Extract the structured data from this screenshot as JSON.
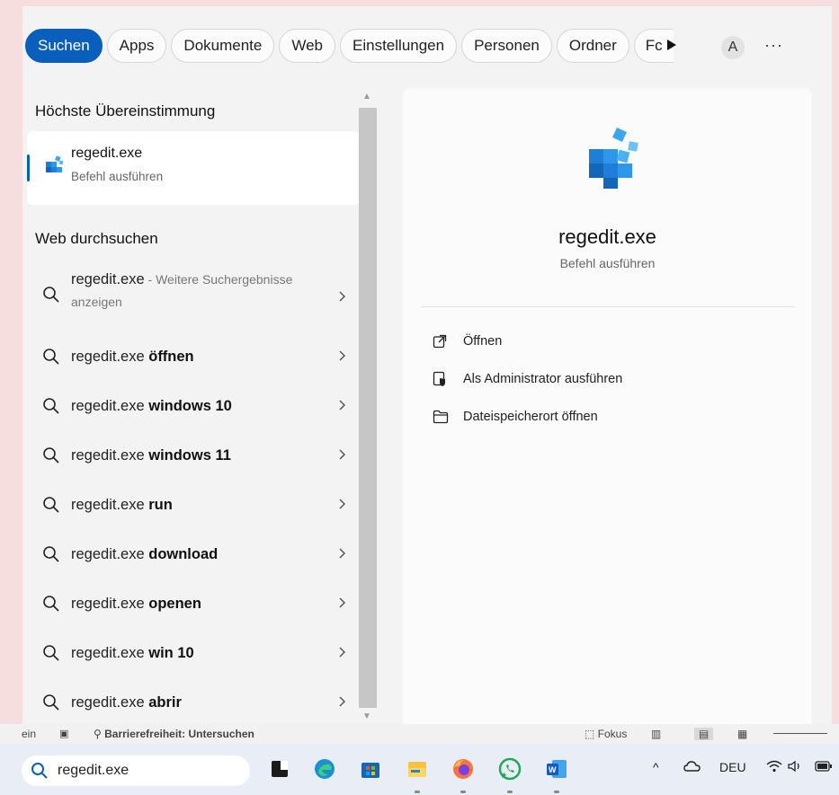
{
  "tabs": [
    {
      "label": "Suchen",
      "active": true
    },
    {
      "label": "Apps"
    },
    {
      "label": "Dokumente"
    },
    {
      "label": "Web"
    },
    {
      "label": "Einstellungen"
    },
    {
      "label": "Personen"
    },
    {
      "label": "Ordner"
    },
    {
      "label": "Fc"
    }
  ],
  "header": {
    "avatar_letter": "A",
    "more": "···"
  },
  "left": {
    "best_match_heading": "Höchste Übereinstimmung",
    "best_match": {
      "title": "regedit.exe",
      "subtitle": "Befehl ausführen"
    },
    "web_heading": "Web durchsuchen",
    "web_first": {
      "prefix": "regedit.exe",
      "rest": " - Weitere Suchergebnisse",
      "line2": "anzeigen"
    },
    "suggestions": [
      {
        "prefix": "regedit.exe ",
        "bold": "öffnen"
      },
      {
        "prefix": "regedit.exe ",
        "bold": "windows 10"
      },
      {
        "prefix": "regedit.exe ",
        "bold": "windows 11"
      },
      {
        "prefix": "regedit.exe ",
        "bold": "run"
      },
      {
        "prefix": "regedit.exe ",
        "bold": "download"
      },
      {
        "prefix": "regedit.exe ",
        "bold": "openen"
      },
      {
        "prefix": "regedit.exe ",
        "bold": "win 10"
      },
      {
        "prefix": "regedit.exe ",
        "bold": "abrir"
      }
    ]
  },
  "detail": {
    "title": "regedit.exe",
    "subtitle": "Befehl ausführen",
    "actions": [
      {
        "label": "Öffnen",
        "icon": "open-external-icon"
      },
      {
        "label": "Als Administrator ausführen",
        "icon": "shield-admin-icon"
      },
      {
        "label": "Dateispeicherort öffnen",
        "icon": "folder-icon"
      }
    ]
  },
  "background_strip": {
    "left": "ein",
    "accessibility": "Barrierefreiheit: Untersuchen",
    "focus": "Fokus"
  },
  "taskbar": {
    "search_value": "regedit.exe",
    "language": "DEU"
  },
  "colors": {
    "accent": "#0a5fbd",
    "panel_bg": "#f3f3f3",
    "page_bg": "#f7dede"
  }
}
